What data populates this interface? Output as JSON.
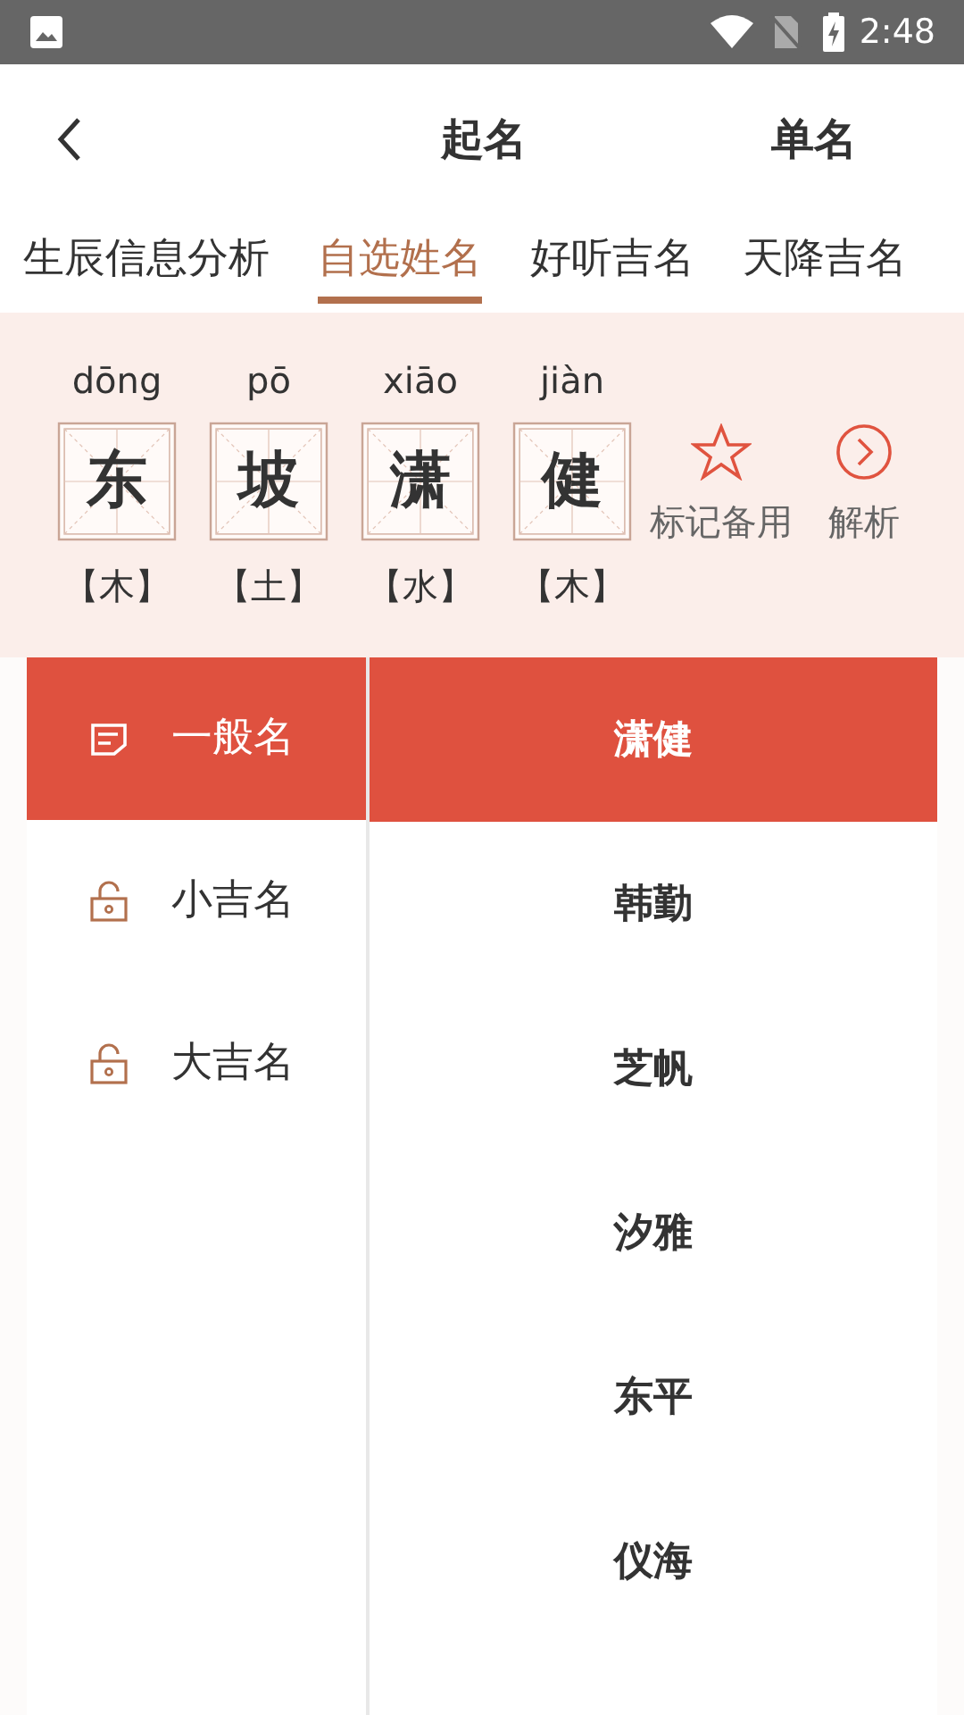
{
  "status_bar": {
    "time": "2:48"
  },
  "header": {
    "title": "起名",
    "action": "单名"
  },
  "tabs": [
    {
      "label": "生辰信息分析",
      "selected": false
    },
    {
      "label": "自选姓名",
      "selected": true
    },
    {
      "label": "好听吉名",
      "selected": false
    },
    {
      "label": "天降吉名",
      "selected": false
    }
  ],
  "name_chars": [
    {
      "pinyin": "dōng",
      "char": "东",
      "element": "【木】"
    },
    {
      "pinyin": "pō",
      "char": "坡",
      "element": "【土】"
    },
    {
      "pinyin": "xiāo",
      "char": "潇",
      "element": "【水】"
    },
    {
      "pinyin": "jiàn",
      "char": "健",
      "element": "【木】"
    }
  ],
  "bookmark": {
    "label": "标记备用",
    "starred": false
  },
  "analysis": {
    "label": "解析"
  },
  "categories": [
    {
      "label": "一般名",
      "selected": true,
      "kind": "open"
    },
    {
      "label": "小吉名",
      "selected": false,
      "kind": "locked"
    },
    {
      "label": "大吉名",
      "selected": false,
      "kind": "locked"
    }
  ],
  "names": [
    {
      "label": "潇健",
      "selected": true
    },
    {
      "label": "韩勤",
      "selected": false
    },
    {
      "label": "芝帆",
      "selected": false
    },
    {
      "label": "汐雅",
      "selected": false
    },
    {
      "label": "东平",
      "selected": false
    },
    {
      "label": "仪海",
      "selected": false
    }
  ]
}
